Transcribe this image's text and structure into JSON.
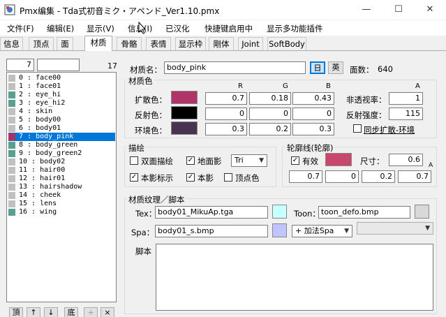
{
  "window": {
    "title": "Pmx编集 - Tda式初音ミク・アペンド_Ver1.10.pmx",
    "minimize": "—",
    "maximize": "☐",
    "close": "✕"
  },
  "menu": [
    "文件(F)",
    "编辑(E)",
    "显示(V)",
    "信息(I)",
    "已汉化",
    "快捷键启用中",
    "显示多功能插件"
  ],
  "tabs": [
    "信息",
    "顶点",
    "面",
    "材质",
    "骨骼",
    "表情",
    "显示枠",
    "剛体",
    "Joint",
    "SoftBody"
  ],
  "active_tab": "材质",
  "list_panel": {
    "index_value": "7",
    "search_value": "",
    "count": "17",
    "items": [
      {
        "label": "0 : face00",
        "color": "#c0c0c0"
      },
      {
        "label": "1 : face01",
        "color": "#c0c0c0"
      },
      {
        "label": "2 : eye_hi",
        "color": "#5aa090"
      },
      {
        "label": "3 : eye_hi2",
        "color": "#5aa090"
      },
      {
        "label": "4 : skin",
        "color": "#c0c0c0"
      },
      {
        "label": "5 : body00",
        "color": "#c0c0c0"
      },
      {
        "label": "6 : body01",
        "color": "#c0c0c0"
      },
      {
        "label": "7 : body_pink",
        "color": "#b03060"
      },
      {
        "label": "8 : body_green",
        "color": "#5aa090"
      },
      {
        "label": "9 : body_green2",
        "color": "#5aa090"
      },
      {
        "label": "10 : body02",
        "color": "#c0c0c0"
      },
      {
        "label": "11 : hair00",
        "color": "#c0c0c0"
      },
      {
        "label": "12 : hair01",
        "color": "#c0c0c0"
      },
      {
        "label": "13 : hairshadow",
        "color": "#c0c0c0"
      },
      {
        "label": "14 : cheek",
        "color": "#c0c0c0"
      },
      {
        "label": "15 : lens",
        "color": "#c0c0c0"
      },
      {
        "label": "16 : wing",
        "color": "#5aa090"
      }
    ],
    "selected_index": 7,
    "buttons": [
      "頂",
      "↑",
      "↓",
      "底",
      "+",
      "×"
    ]
  },
  "material": {
    "name_label": "材质名：",
    "name_value": "body_pink",
    "jp_button": "日",
    "en_button": "英",
    "faces_label": "面数：",
    "faces_value": "640",
    "color_group": "材质色",
    "col_r": "R",
    "col_g": "G",
    "col_b": "B",
    "col_a": "A",
    "diffuse_label": "扩散色：",
    "diffuse_color": "#b03468",
    "diffuse": [
      "0.7",
      "0.18",
      "0.43"
    ],
    "specular_label": "反射色：",
    "specular_color": "#000000",
    "specular": [
      "0",
      "0",
      "0"
    ],
    "ambient_label": "环境色：",
    "ambient_color": "#4a3350",
    "ambient": [
      "0.3",
      "0.2",
      "0.3"
    ],
    "alpha_label": "非透视率：",
    "alpha_value": "1",
    "spec_power_label": "反射强度：",
    "spec_power_value": "115",
    "sync_label": "同步扩散-环境",
    "sync_checked": false
  },
  "draw": {
    "group": "描绘",
    "double_sided": "双面描绘",
    "double_sided_checked": false,
    "ground_shadow": "地面影",
    "ground_shadow_checked": true,
    "prim_select": "Tri",
    "self_shadow_map": "本影标示",
    "self_shadow_map_checked": true,
    "self_shadow": "本影",
    "self_shadow_checked": true,
    "vertex_color": "顶点色",
    "vertex_color_checked": false
  },
  "edge": {
    "group": "轮廓线(轮廓)",
    "enabled_label": "有效",
    "enabled_checked": true,
    "color": "#c8476c",
    "size_label": "尺寸：",
    "size_value": "0.6",
    "col_a": "A",
    "rgba": [
      "0.7",
      "0",
      "0.2",
      "0.7"
    ]
  },
  "texture": {
    "group": "材质纹理／脚本",
    "tex_label": "Tex：",
    "tex_value": "body01_MikuAp.tga",
    "tex_color": "#c8ffff",
    "toon_label": "Toon：",
    "toon_value": "toon_defo.bmp",
    "toon_color": "#d8d8d8",
    "spa_label": "Spa：",
    "spa_value": "body01_s.bmp",
    "spa_color": "#c0c4ff",
    "spa_mode": "+ 加法Spa",
    "extra_select": "",
    "script_label": "脚本"
  }
}
